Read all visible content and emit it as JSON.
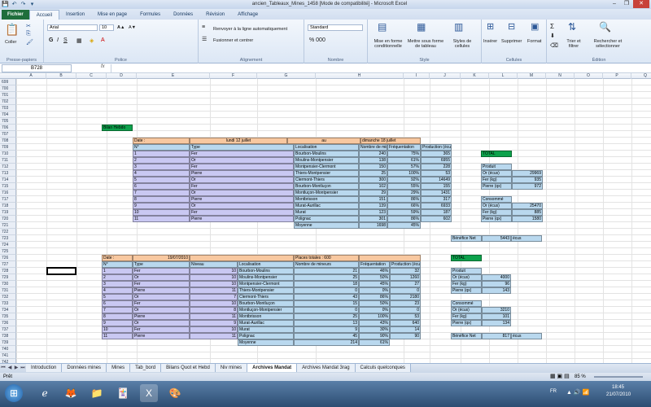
{
  "window": {
    "title": "ancien_Tableaux_Mines_1458  [Mode de compatibilité]  -  Microsoft Excel",
    "minimize": "–",
    "restore": "❐",
    "close": "✕"
  },
  "qat": [
    "💾",
    "↶",
    "↷",
    "▾"
  ],
  "ribbon_tabs": [
    "Fichier",
    "Accueil",
    "Insertion",
    "Mise en page",
    "Formules",
    "Données",
    "Révision",
    "Affichage"
  ],
  "ribbon": {
    "paste": "Coller",
    "clipboard": "Presse-papiers",
    "font_name": "Arial",
    "font_size": "10",
    "police": "Police",
    "wrap": "Renvoyer à la ligne automatiquement",
    "merge": "Fusionner et centrer",
    "alignment": "Alignement",
    "number_format": "Standard",
    "number": "Nombre",
    "cond_format": "Mise en forme conditionnelle",
    "table_format": "Mettre sous forme de tableau",
    "cell_styles": "Styles de cellules",
    "style": "Style",
    "insert": "Insérer",
    "delete": "Supprimer",
    "format": "Format",
    "cells": "Cellules",
    "sort": "Trier et filtrer",
    "find": "Rechercher et sélectionner",
    "edition": "Édition"
  },
  "formula_bar": {
    "name_box": "B728",
    "fx": "fx",
    "formula": ""
  },
  "columns": [
    "A",
    "B",
    "C",
    "D",
    "E",
    "F",
    "G",
    "H",
    "I",
    "J",
    "K",
    "L",
    "M",
    "N",
    "O",
    "P",
    "Q"
  ],
  "rows": [
    "699",
    "700",
    "701",
    "702",
    "703",
    "704",
    "705",
    "706",
    "707",
    "708",
    "709",
    "710",
    "711",
    "712",
    "713",
    "714",
    "715",
    "716",
    "717",
    "718",
    "719",
    "720",
    "721",
    "722",
    "723",
    "724",
    "725",
    "726",
    "727",
    "728",
    "729",
    "730",
    "731",
    "732",
    "733",
    "734",
    "735",
    "736",
    "737",
    "738",
    "739",
    "740",
    "741",
    "742"
  ],
  "t1": {
    "bilan": "Bilan Hebdo",
    "date_label": "Date :",
    "date_from": "lundi 12 juillet",
    "au": "au",
    "date_to": "dimanche 18 juillet",
    "headers": [
      "N°",
      "Type",
      "Localisation",
      "Nombre de mineurs",
      "Fréquentation",
      "Production (écus, kg, qx)"
    ],
    "rows": [
      [
        "1",
        "Fer",
        "Bourbon-Moulins",
        "240",
        "75%",
        "365"
      ],
      [
        "2",
        "Or",
        "Moulins-Montpensier",
        "138",
        "61%",
        "6955"
      ],
      [
        "3",
        "Fer",
        "Montpensier-Clermont",
        "150",
        "57%",
        "228"
      ],
      [
        "4",
        "Pierre",
        "Thiers-Montpensier",
        "25",
        "100%",
        "53"
      ],
      [
        "5",
        "Or",
        "Clermont-Thiers",
        "300",
        "92%",
        "14649"
      ],
      [
        "6",
        "Fer",
        "Bourbon-Montluçon",
        "102",
        "55%",
        "155"
      ],
      [
        "7",
        "Or",
        "Montluçon-Montpensier",
        "29",
        "29%",
        "1431"
      ],
      [
        "8",
        "Pierre",
        "Montbrisson",
        "151",
        "86%",
        "317"
      ],
      [
        "9",
        "Or",
        "Murat-Aurillac",
        "139",
        "66%",
        "6933"
      ],
      [
        "10",
        "Fer",
        "Murat",
        "123",
        "59%",
        "187"
      ],
      [
        "11",
        "Pierre",
        "Polignac",
        "301",
        "86%",
        "602"
      ]
    ],
    "moyenne_label": "Moyenne",
    "moyenne_mineurs": "1698",
    "moyenne_freq": "45%",
    "total_label": "TOTAL",
    "produit_label": "Produit",
    "produit": [
      [
        "Or (écus)",
        "29969"
      ],
      [
        "Fer (kg)",
        "935"
      ],
      [
        "Pierre (qx)",
        "972"
      ]
    ],
    "conso_label": "Consommé",
    "conso": [
      [
        "Or (écus)",
        "25470"
      ],
      [
        "Fer (kg)",
        "885"
      ],
      [
        "Pierre (qx)",
        "1580"
      ]
    ],
    "benefice_label": "Bénéfice Net",
    "benefice": "5443",
    "benefice_unit": "écus"
  },
  "t2": {
    "date_label": "Date :",
    "date": "19/07/2010",
    "places": "Places totales : 600",
    "headers": [
      "N°",
      "Type",
      "Niveau",
      "Localisation",
      "Nombre de mineurs",
      "Fréquentation",
      "Production (écus, kg, qx)"
    ],
    "rows": [
      [
        "1",
        "Fer",
        "10",
        "Bourbon-Moulins",
        "21",
        "46%",
        "32"
      ],
      [
        "2",
        "Or",
        "10",
        "Moulins-Montpensier",
        "25",
        "50%",
        "1260"
      ],
      [
        "3",
        "Fer",
        "10",
        "Montpensier-Clermont",
        "18",
        "45%",
        "27"
      ],
      [
        "4",
        "Pierre",
        "11",
        "Thiers-Montpensier",
        "0",
        "0%",
        "0"
      ],
      [
        "5",
        "Or",
        "7",
        "Clermont-Thiers",
        "43",
        "86%",
        "2180"
      ],
      [
        "6",
        "Fer",
        "10",
        "Bourbon-Montluçon",
        "15",
        "50%",
        "23"
      ],
      [
        "7",
        "Or",
        "8",
        "Montluçon-Montpensier",
        "0",
        "0%",
        "0"
      ],
      [
        "8",
        "Pierre",
        "11",
        "Montbrisson",
        "25",
        "100%",
        "53"
      ],
      [
        "9",
        "Or",
        "9",
        "Murat-Aurillac",
        "13",
        "43%",
        "640"
      ],
      [
        "10",
        "Fer",
        "10",
        "Murat",
        "9",
        "30%",
        "14"
      ],
      [
        "11",
        "Pierre",
        "11",
        "Polignac",
        "45",
        "90%",
        "90"
      ]
    ],
    "moyenne_label": "Moyenne",
    "moyenne_mineurs": "214",
    "moyenne_freq": "61%",
    "total_label": "TOTAL",
    "produit_label": "Produit",
    "produit": [
      [
        "Or (écus)",
        "4000"
      ],
      [
        "Fer (kg)",
        "96"
      ],
      [
        "Pierre (qx)",
        "143"
      ]
    ],
    "conso_label": "Consommé",
    "conso": [
      [
        "Or (écus)",
        "3210"
      ],
      [
        "Fer (kg)",
        "101"
      ],
      [
        "Pierre (qx)",
        "134"
      ]
    ],
    "benefice_label": "Bénéfice Net",
    "benefice": "817",
    "benefice_unit": "écus"
  },
  "sheet_tabs": [
    "Introduction",
    "Données mines",
    "Mines",
    "Tab_bord",
    "Bilans Quot et Hebd",
    "Niv mines",
    "Archives Mandat",
    "Archives Mandat 3rag",
    "Calculs quelconques"
  ],
  "active_sheet": "Archives Mandat",
  "status": {
    "ready": "Prêt",
    "zoom": "85 %"
  },
  "taskbar": {
    "lang": "FR",
    "time": "18:45",
    "date": "21/07/2010"
  }
}
